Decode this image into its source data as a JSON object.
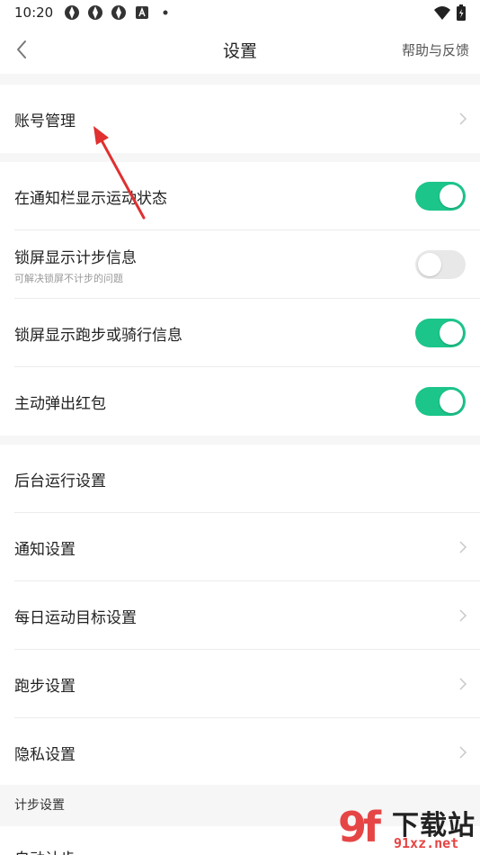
{
  "status_bar": {
    "time": "10:20"
  },
  "navbar": {
    "title": "设置",
    "help_label": "帮助与反馈"
  },
  "account": {
    "label": "账号管理"
  },
  "toggles": [
    {
      "label": "在通知栏显示运动状态",
      "sub": "",
      "on": true
    },
    {
      "label": "锁屏显示计步信息",
      "sub": "可解决锁屏不计步的问题",
      "on": false
    },
    {
      "label": "锁屏显示跑步或骑行信息",
      "sub": "",
      "on": true
    },
    {
      "label": "主动弹出红包",
      "sub": "",
      "on": true
    }
  ],
  "settings": [
    {
      "label": "后台运行设置",
      "chevron": false
    },
    {
      "label": "通知设置",
      "chevron": true
    },
    {
      "label": "每日运动目标设置",
      "chevron": true
    },
    {
      "label": "跑步设置",
      "chevron": true
    },
    {
      "label": "隐私设置",
      "chevron": true
    }
  ],
  "step_section": {
    "header": "计步设置",
    "first_item_label": "自动计步"
  },
  "watermark": {
    "logo": "9f",
    "text": "下载站",
    "url": "91xz.net"
  },
  "colors": {
    "switch_on": "#1cc58a",
    "switch_off": "#e8e8e8",
    "arrow": "#e03030",
    "watermark": "#e64545"
  }
}
